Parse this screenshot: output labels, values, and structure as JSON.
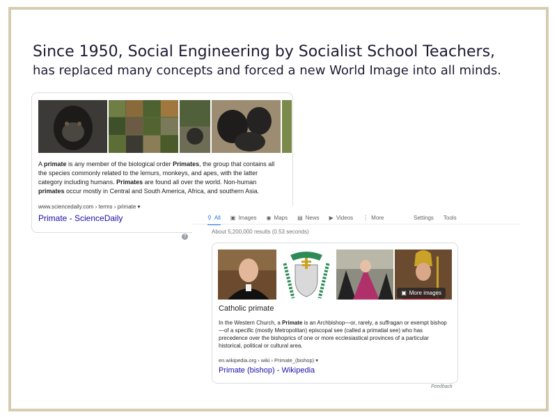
{
  "headline": {
    "line1": "Since 1950, Social Engineering by Socialist School Teachers,",
    "line2": "has replaced many concepts and forced a new World Image into all minds."
  },
  "card_primate": {
    "desc": {
      "t1": "A ",
      "b1": "primate",
      "t2": " is any member of the biological order ",
      "b2": "Primates",
      "t3": ", the group that contains all the species commonly related to the lemurs, monkeys, and apes, with the latter category including humans. ",
      "b3": "Primates",
      "t4": " are found all over the world. Non-human ",
      "b4": "primates",
      "t5": " occur mostly in Central and South America, Africa, and southern Asia."
    },
    "cite": "www.sciencedaily.com › terms › primate ▾",
    "link": "Primate - ScienceDaily"
  },
  "search": {
    "tabs": [
      {
        "label": "All",
        "icon": "search-icon"
      },
      {
        "label": "Images",
        "icon": "image-icon"
      },
      {
        "label": "Maps",
        "icon": "map-pin-icon"
      },
      {
        "label": "News",
        "icon": "news-icon"
      },
      {
        "label": "Videos",
        "icon": "video-icon"
      },
      {
        "label": "More",
        "icon": "more-dots-icon"
      }
    ],
    "settings": "Settings",
    "tools": "Tools",
    "results": "About 5,200,000 results (0.53 seconds)"
  },
  "card_bishop": {
    "more_images": "More images",
    "title": "Catholic primate",
    "desc": {
      "t1": "In the Western Church, a ",
      "b1": "Primate",
      "t2": " is an Archbishop—or, rarely, a suffragan or exempt bishop—of a specific (mostly Metropolitan) episcopal see (called a primatial see) who has precedence over the bishoprics of one or more ecclesiastical provinces of a particular historical, political or cultural area."
    },
    "cite": "en.wikipedia.org › wiki › Primate_(bishop) ▾",
    "link": "Primate (bishop) - Wikipedia",
    "feedback": "Feedback"
  },
  "colors": {
    "frame": "#d6ccb0",
    "link": "#1a0dab",
    "active_tab": "#1a73e8"
  }
}
